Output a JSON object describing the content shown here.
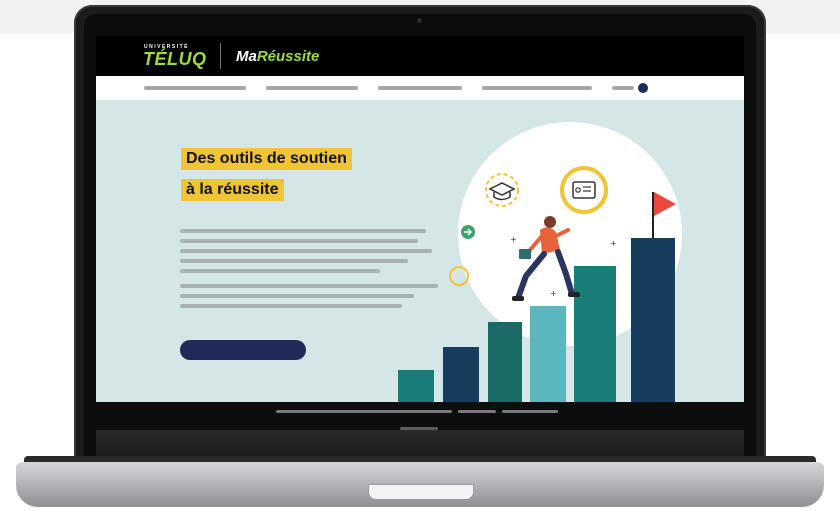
{
  "app": {
    "university_small": "UNIVERSITÉ",
    "university_big": "TÉLUQ",
    "brand_prefix": "Ma",
    "brand_suffix": "Réussite",
    "accent_color": "#9ddc3c"
  },
  "hero": {
    "headline_line1": "Des outils de soutien",
    "headline_line2": "à la réussite",
    "highlight_color": "#f0c435",
    "cta_color": "#222a5a"
  },
  "illustration": {
    "icons": [
      "graduation-cap-icon",
      "certificate-icon",
      "arrow-right-icon",
      "flag-icon"
    ]
  }
}
